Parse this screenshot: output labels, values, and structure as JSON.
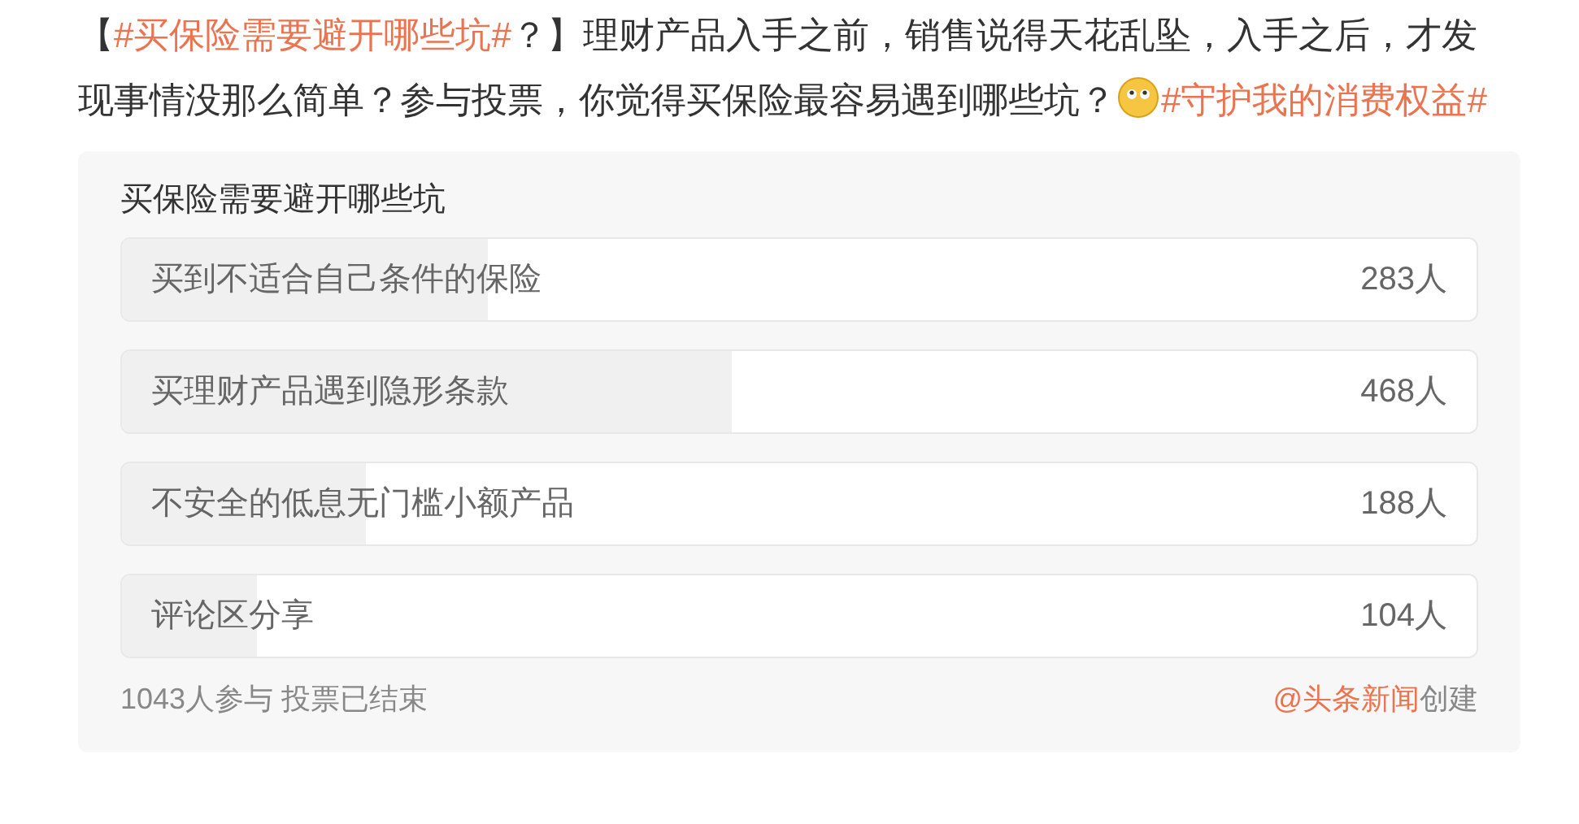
{
  "post": {
    "segments": [
      {
        "kind": "text",
        "text": "【"
      },
      {
        "kind": "hashtag",
        "text": "#买保险需要避开哪些坑#"
      },
      {
        "kind": "text",
        "text": "？】理财产品入手之前，销售说得天花乱坠，入手之后，才发现事情没那么简单？参与投票，你觉得买保险最容易遇到哪些坑？"
      },
      {
        "kind": "emoji"
      },
      {
        "kind": "hashtag",
        "text": "#守护我的消费权益#"
      }
    ]
  },
  "poll": {
    "title": "买保险需要避开哪些坑",
    "options": [
      {
        "label": "买到不适合自己条件的保险",
        "count": "283人",
        "level": 0.27
      },
      {
        "label": "买理财产品遇到隐形条款",
        "count": "468人",
        "level": 0.45
      },
      {
        "label": "不安全的低息无门槛小额产品",
        "count": "188人",
        "level": 0.18
      },
      {
        "label": "评论区分享",
        "count": "104人",
        "level": 0.1
      }
    ],
    "summary": "1043人参与 投票已结束",
    "creator": {
      "account": "@头条新闻",
      "suffix": "创建"
    }
  }
}
